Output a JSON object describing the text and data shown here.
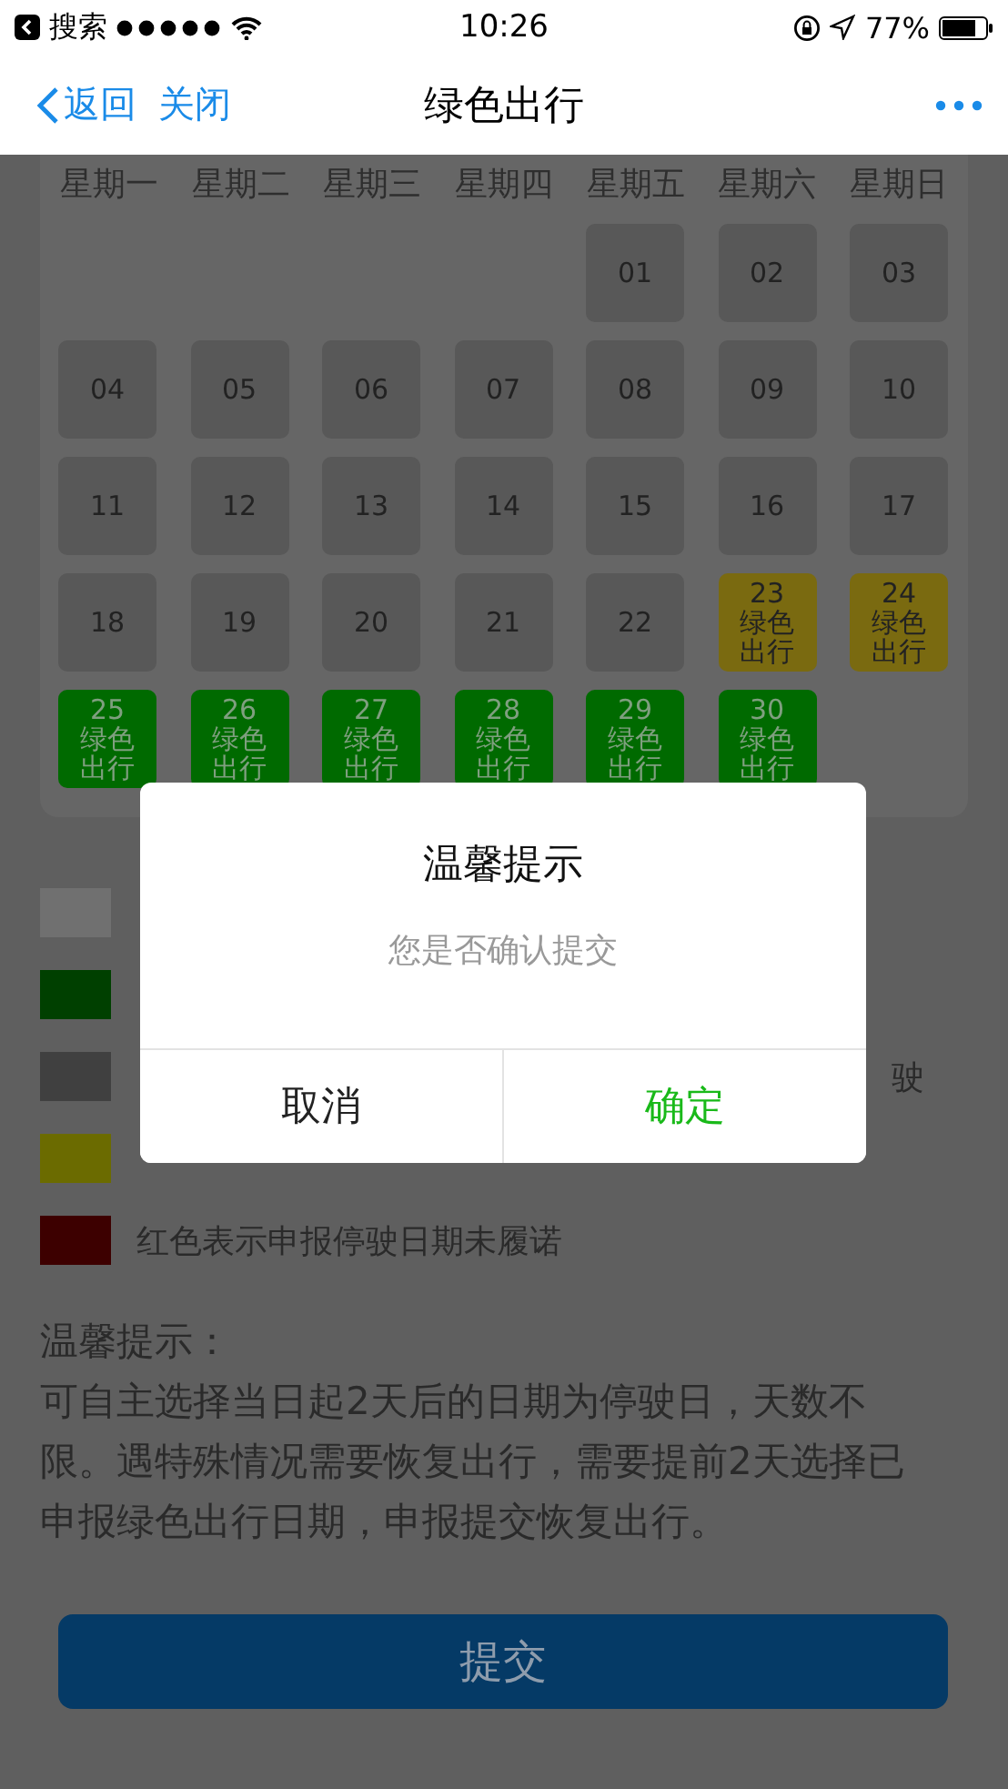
{
  "status_bar": {
    "back_app": "搜索",
    "time": "10:26",
    "battery": "77%"
  },
  "nav": {
    "back": "返回",
    "close": "关闭",
    "title": "绿色出行"
  },
  "calendar": {
    "weekdays": [
      "星期一",
      "星期二",
      "星期三",
      "星期四",
      "星期五",
      "星期六",
      "星期日"
    ],
    "weeks": [
      [
        {
          "kind": "blank"
        },
        {
          "kind": "blank"
        },
        {
          "kind": "blank"
        },
        {
          "kind": "blank"
        },
        {
          "kind": "day",
          "day": "01",
          "color": "#585858"
        },
        {
          "kind": "day",
          "day": "02",
          "color": "#585858"
        },
        {
          "kind": "day",
          "day": "03",
          "color": "#585858"
        }
      ],
      [
        {
          "kind": "day",
          "day": "04",
          "color": "#585858"
        },
        {
          "kind": "day",
          "day": "05",
          "color": "#585858"
        },
        {
          "kind": "day",
          "day": "06",
          "color": "#585858"
        },
        {
          "kind": "day",
          "day": "07",
          "color": "#585858"
        },
        {
          "kind": "day",
          "day": "08",
          "color": "#585858"
        },
        {
          "kind": "day",
          "day": "09",
          "color": "#585858"
        },
        {
          "kind": "day",
          "day": "10",
          "color": "#585858"
        }
      ],
      [
        {
          "kind": "day",
          "day": "11",
          "color": "#585858"
        },
        {
          "kind": "day",
          "day": "12",
          "color": "#585858"
        },
        {
          "kind": "day",
          "day": "13",
          "color": "#585858"
        },
        {
          "kind": "day",
          "day": "14",
          "color": "#585858"
        },
        {
          "kind": "day",
          "day": "15",
          "color": "#585858"
        },
        {
          "kind": "day",
          "day": "16",
          "color": "#585858"
        },
        {
          "kind": "day",
          "day": "17",
          "color": "#585858"
        }
      ],
      [
        {
          "kind": "day",
          "day": "18",
          "color": "#585858"
        },
        {
          "kind": "day",
          "day": "19",
          "color": "#585858"
        },
        {
          "kind": "day",
          "day": "20",
          "color": "#585858"
        },
        {
          "kind": "day",
          "day": "21",
          "color": "#585858"
        },
        {
          "kind": "day",
          "day": "22",
          "color": "#585858"
        },
        {
          "kind": "day",
          "day": "23",
          "color": "#7a6a10",
          "note": "绿色出行"
        },
        {
          "kind": "day",
          "day": "24",
          "color": "#7a6a10",
          "note": "绿色出行"
        }
      ],
      [
        {
          "kind": "day",
          "day": "25",
          "color": "#006a00",
          "note": "绿色出行"
        },
        {
          "kind": "day",
          "day": "26",
          "color": "#006a00",
          "note": "绿色出行"
        },
        {
          "kind": "day",
          "day": "27",
          "color": "#006a00",
          "note": "绿色出行"
        },
        {
          "kind": "day",
          "day": "28",
          "color": "#006a00",
          "note": "绿色出行"
        },
        {
          "kind": "day",
          "day": "29",
          "color": "#006a00",
          "note": "绿色出行"
        },
        {
          "kind": "day",
          "day": "30",
          "color": "#006a00",
          "note": "绿色出行"
        },
        {
          "kind": "blank"
        }
      ]
    ]
  },
  "legend": [
    {
      "color": "#707070",
      "kind": "hidden"
    },
    {
      "color": "#004000",
      "kind": "hidden"
    },
    {
      "color": "#404040",
      "kind": "tail",
      "label": "驶"
    },
    {
      "color": "#6b6b00",
      "kind": "hidden"
    },
    {
      "color": "#3d0000",
      "kind": "full",
      "label": "红色表示申报停驶日期未履诺"
    }
  ],
  "tips": {
    "title": "温馨提示：",
    "body": "可自主选择当日起2天后的日期为停驶日，天数不限。遇特殊情况需要恢复出行，需要提前2天选择已申报绿色出行日期，申报提交恢复出行。"
  },
  "submit": "提交",
  "dialog": {
    "title": "温馨提示",
    "message": "您是否确认提交",
    "buttons": [
      {
        "label": "取消",
        "kind": "cancel"
      },
      {
        "label": "确定",
        "kind": "confirm"
      }
    ]
  }
}
